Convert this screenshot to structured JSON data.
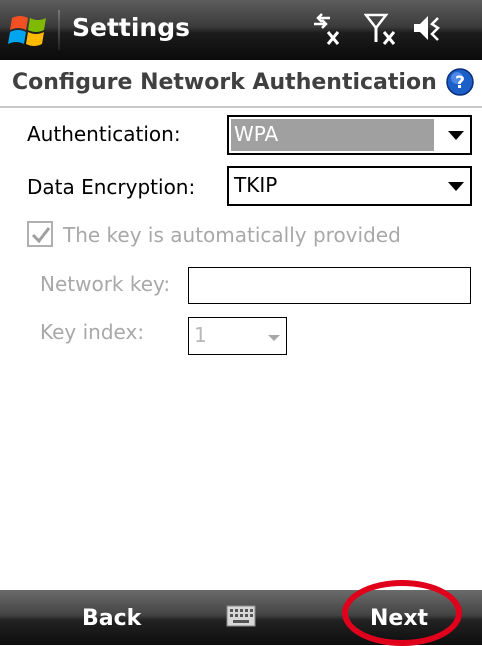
{
  "titlebar": {
    "title": "Settings",
    "status_icons": [
      "connectivity-icon",
      "signal-off-icon",
      "volume-off-icon"
    ]
  },
  "header": {
    "title": "Configure Network Authentication",
    "help_icon": "help-icon"
  },
  "form": {
    "authentication": {
      "label": "Authentication:",
      "value": "WPA"
    },
    "data_encryption": {
      "label": "Data Encryption:",
      "value": "TKIP"
    },
    "auto_key": {
      "label": "The key is automatically provided",
      "checked": true
    },
    "network_key": {
      "label": "Network key:",
      "value": ""
    },
    "key_index": {
      "label": "Key index:",
      "value": "1"
    }
  },
  "softkeys": {
    "left": "Back",
    "center_icon": "keyboard-icon",
    "right": "Next"
  },
  "colors": {
    "annotation_ring": "#e0001b",
    "disabled_text": "#a8a8a8",
    "selected_field": "#a0a0a0"
  }
}
